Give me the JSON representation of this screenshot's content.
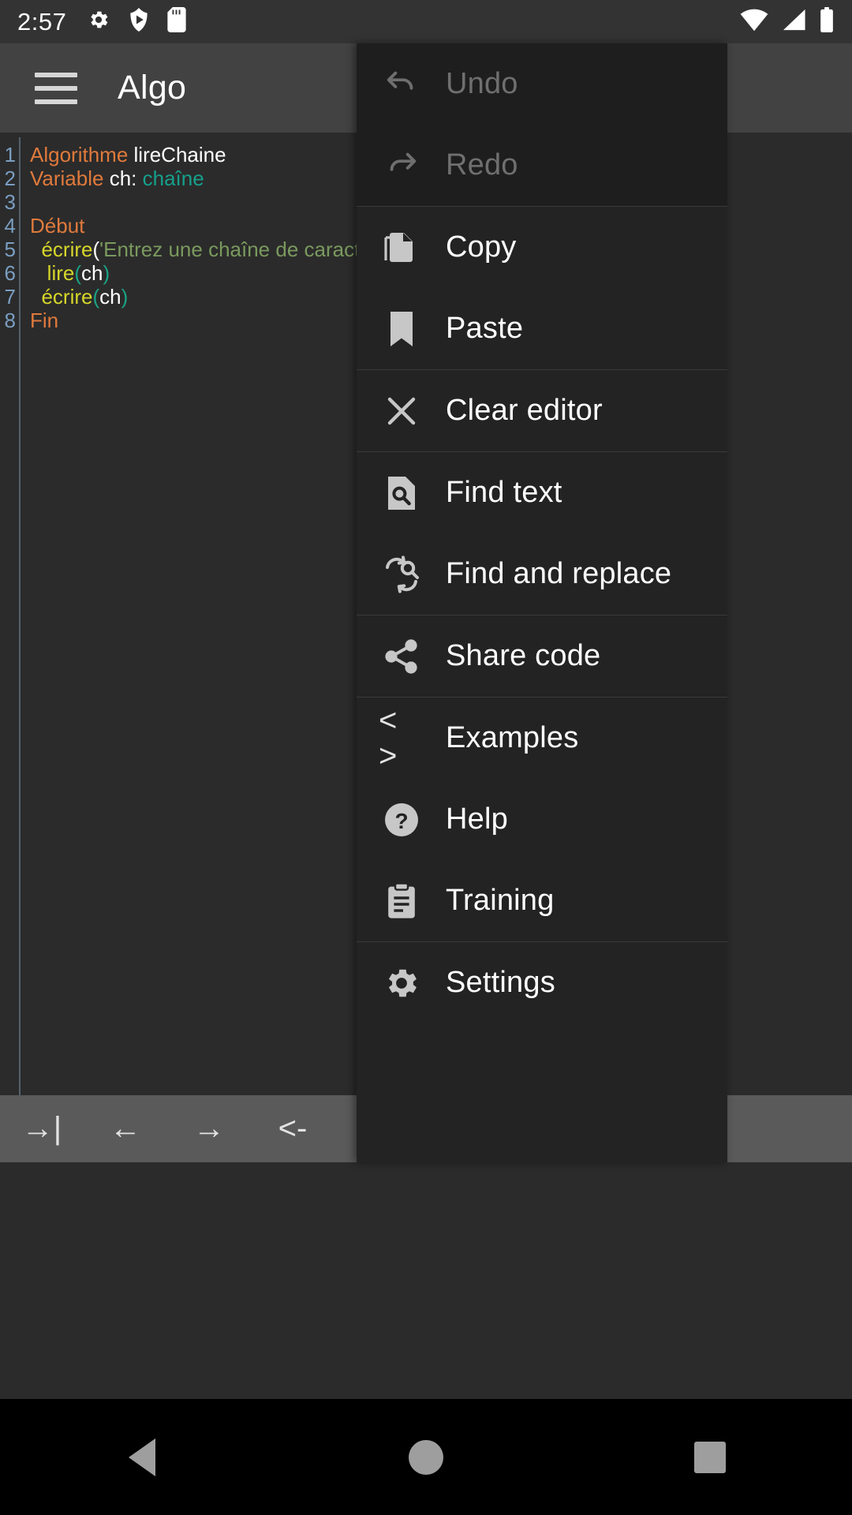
{
  "status_bar": {
    "time": "2:57",
    "left_icons": [
      "gear-icon",
      "play-protect-icon",
      "sd-card-icon"
    ],
    "right_icons": [
      "wifi-icon",
      "cellular-signal-icon",
      "battery-icon"
    ]
  },
  "app_bar": {
    "menu_icon": "hamburger-menu-icon",
    "title": "Algo"
  },
  "editor": {
    "line_numbers": [
      "1",
      "2",
      "3",
      "4",
      "5",
      "6",
      "7",
      "8"
    ],
    "lines": [
      {
        "n": "1",
        "tokens": [
          {
            "t": "Algorithme",
            "c": "kw"
          },
          {
            "t": " ",
            "c": "punc"
          },
          {
            "t": "lireChaine",
            "c": "id"
          }
        ]
      },
      {
        "n": "2",
        "tokens": [
          {
            "t": "Variable",
            "c": "kw"
          },
          {
            "t": " ",
            "c": "punc"
          },
          {
            "t": "ch",
            "c": "id"
          },
          {
            "t": ":",
            "c": "punc"
          },
          {
            "t": " ",
            "c": "punc"
          },
          {
            "t": "chaîne",
            "c": "type"
          }
        ]
      },
      {
        "n": "3",
        "tokens": []
      },
      {
        "n": "4",
        "tokens": [
          {
            "t": "Début",
            "c": "kw"
          }
        ]
      },
      {
        "n": "5",
        "tokens": [
          {
            "t": "  ",
            "c": "punc"
          },
          {
            "t": "écrire",
            "c": "fn"
          },
          {
            "t": "(",
            "c": "punc"
          },
          {
            "t": "'Entrez une chaîne de caractères'",
            "c": "str"
          }
        ]
      },
      {
        "n": "6",
        "tokens": [
          {
            "t": "   ",
            "c": "punc"
          },
          {
            "t": "lire",
            "c": "fn"
          },
          {
            "t": "(",
            "c": "paren"
          },
          {
            "t": "ch",
            "c": "id"
          },
          {
            "t": ")",
            "c": "paren"
          }
        ]
      },
      {
        "n": "7",
        "tokens": [
          {
            "t": "  ",
            "c": "punc"
          },
          {
            "t": "écrire",
            "c": "fn"
          },
          {
            "t": "(",
            "c": "paren"
          },
          {
            "t": "ch",
            "c": "id"
          },
          {
            "t": ")",
            "c": "paren"
          }
        ]
      },
      {
        "n": "8",
        "tokens": [
          {
            "t": "Fin",
            "c": "kw"
          }
        ]
      }
    ]
  },
  "editor_toolbar": {
    "buttons": [
      {
        "name": "tab-indent-button",
        "label": "→|"
      },
      {
        "name": "move-left-button",
        "label": "←"
      },
      {
        "name": "move-right-button",
        "label": "→"
      },
      {
        "name": "dedent-button",
        "label": "<-"
      },
      {
        "name": "back-button",
        "label": "<"
      }
    ]
  },
  "menu": {
    "groups": [
      {
        "dim": true,
        "items": [
          {
            "label": "Undo",
            "icon": "undo-icon",
            "disabled": true
          },
          {
            "label": "Redo",
            "icon": "redo-icon",
            "disabled": true
          }
        ]
      },
      {
        "dim": false,
        "items": [
          {
            "label": "Copy",
            "icon": "copy-icon",
            "disabled": false
          },
          {
            "label": "Paste",
            "icon": "paste-bookmark-icon",
            "disabled": false
          }
        ]
      },
      {
        "dim": false,
        "items": [
          {
            "label": "Clear editor",
            "icon": "close-x-icon",
            "disabled": false
          }
        ]
      },
      {
        "dim": false,
        "items": [
          {
            "label": "Find text",
            "icon": "find-document-icon",
            "disabled": false
          },
          {
            "label": "Find and replace",
            "icon": "find-replace-icon",
            "disabled": false
          }
        ]
      },
      {
        "dim": false,
        "items": [
          {
            "label": "Share code",
            "icon": "share-icon",
            "disabled": false
          }
        ]
      },
      {
        "dim": false,
        "items": [
          {
            "label": "Examples",
            "icon": "code-brackets-icon",
            "disabled": false
          },
          {
            "label": "Help",
            "icon": "help-circle-icon",
            "disabled": false
          },
          {
            "label": "Training",
            "icon": "clipboard-icon",
            "disabled": false
          }
        ]
      },
      {
        "dim": false,
        "items": [
          {
            "label": "Settings",
            "icon": "gear-icon",
            "disabled": false
          }
        ]
      }
    ]
  },
  "nav_bar": {
    "back": "back-triangle-icon",
    "home": "home-circle-icon",
    "recents": "recents-square-icon"
  },
  "colors": {
    "status_bar_bg": "#333333",
    "app_bar_bg": "#424242",
    "editor_bg": "#2b2b2b",
    "menu_bg": "#232323",
    "menu_dim_bg": "#1e1e1e",
    "toolbar_bg": "#5a5a5a",
    "keyword": "#e07a3c",
    "type": "#15a08c",
    "function": "#d6d62a",
    "string": "#7a9a5e",
    "line_number": "#7a9ec2"
  }
}
